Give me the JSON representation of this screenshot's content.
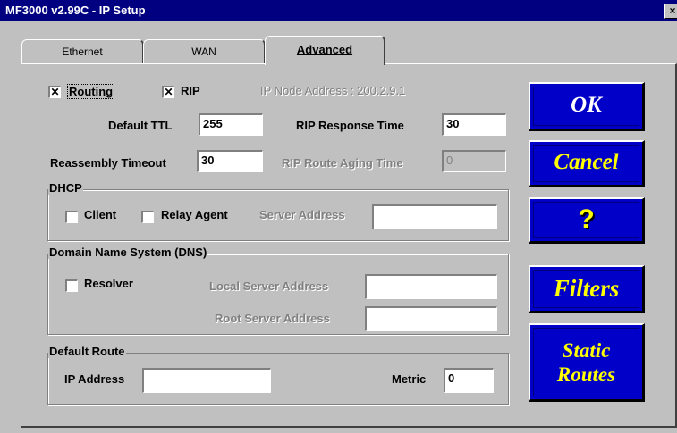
{
  "window": {
    "title": "MF3000 v2.99C - IP Setup",
    "close": "×"
  },
  "tabs": [
    {
      "label": "Ethernet"
    },
    {
      "label": "WAN"
    },
    {
      "label": "Advanced"
    }
  ],
  "routing": {
    "label": "Routing",
    "checked": true
  },
  "rip": {
    "label": "RIP",
    "checked": true
  },
  "ip_node_address": "IP Node Address : 200.2.9.1",
  "default_ttl": {
    "label": "Default TTL",
    "value": "255"
  },
  "rip_response_time": {
    "label": "RIP Response Time",
    "value": "30"
  },
  "reassembly_timeout": {
    "label": "Reassembly Timeout",
    "value": "30"
  },
  "rip_route_aging_time": {
    "label": "RIP Route Aging Time",
    "value": "0"
  },
  "dhcp": {
    "title": "DHCP",
    "client": {
      "label": "Client",
      "checked": false
    },
    "relay_agent": {
      "label": "Relay Agent",
      "checked": false
    },
    "server_address_label": "Server Address",
    "server_address_value": ""
  },
  "dns": {
    "title": "Domain Name System (DNS)",
    "resolver": {
      "label": "Resolver",
      "checked": false
    },
    "local_server_label": "Local Server Address",
    "local_server_value": "",
    "root_server_label": "Root Server Address",
    "root_server_value": ""
  },
  "default_route": {
    "title": "Default Route",
    "ip_label": "IP Address",
    "ip_value": "",
    "metric_label": "Metric",
    "metric_value": "0"
  },
  "buttons": {
    "ok": "OK",
    "cancel": "Cancel",
    "help": "?",
    "filters": "Filters",
    "static_routes_line1": "Static",
    "static_routes_line2": "Routes"
  },
  "colors": {
    "title_bar": "#000080",
    "button_blue": "#0000c8",
    "button_text": "#ffff00",
    "face": "#c0c0c0"
  }
}
